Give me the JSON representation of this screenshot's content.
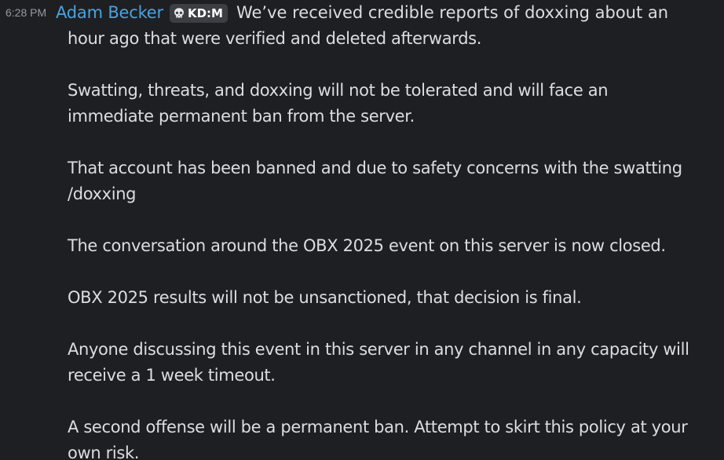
{
  "message": {
    "timestamp": "6:28 PM",
    "username": "Adam Becker",
    "tag": {
      "icon": "skull-icon",
      "label": "KD:M"
    },
    "first_line": "We’ve received credible reports of doxxing about an",
    "lines": [
      "hour ago that were verified and deleted afterwards.",
      "",
      "Swatting, threats, and doxxing will not be tolerated and will face an",
      "immediate permanent ban from the server.",
      "",
      "That account has been banned and due to safety concerns with the swatting",
      "/doxxing",
      "",
      "The conversation around the OBX 2025 event on this server is now closed.",
      "",
      "OBX 2025 results will not be unsanctioned, that decision is final.",
      "",
      "Anyone discussing this event in this server in any channel in any capacity will",
      "receive a 1 week timeout.",
      "",
      "A second offense will be a permanent ban. Attempt to skirt this policy at your",
      "own risk."
    ]
  },
  "colors": {
    "background": "#1e1f22",
    "text": "#dbdee1",
    "timestamp": "#949ba4",
    "username": "#4aa3df",
    "tag_background": "#3c3e44"
  }
}
